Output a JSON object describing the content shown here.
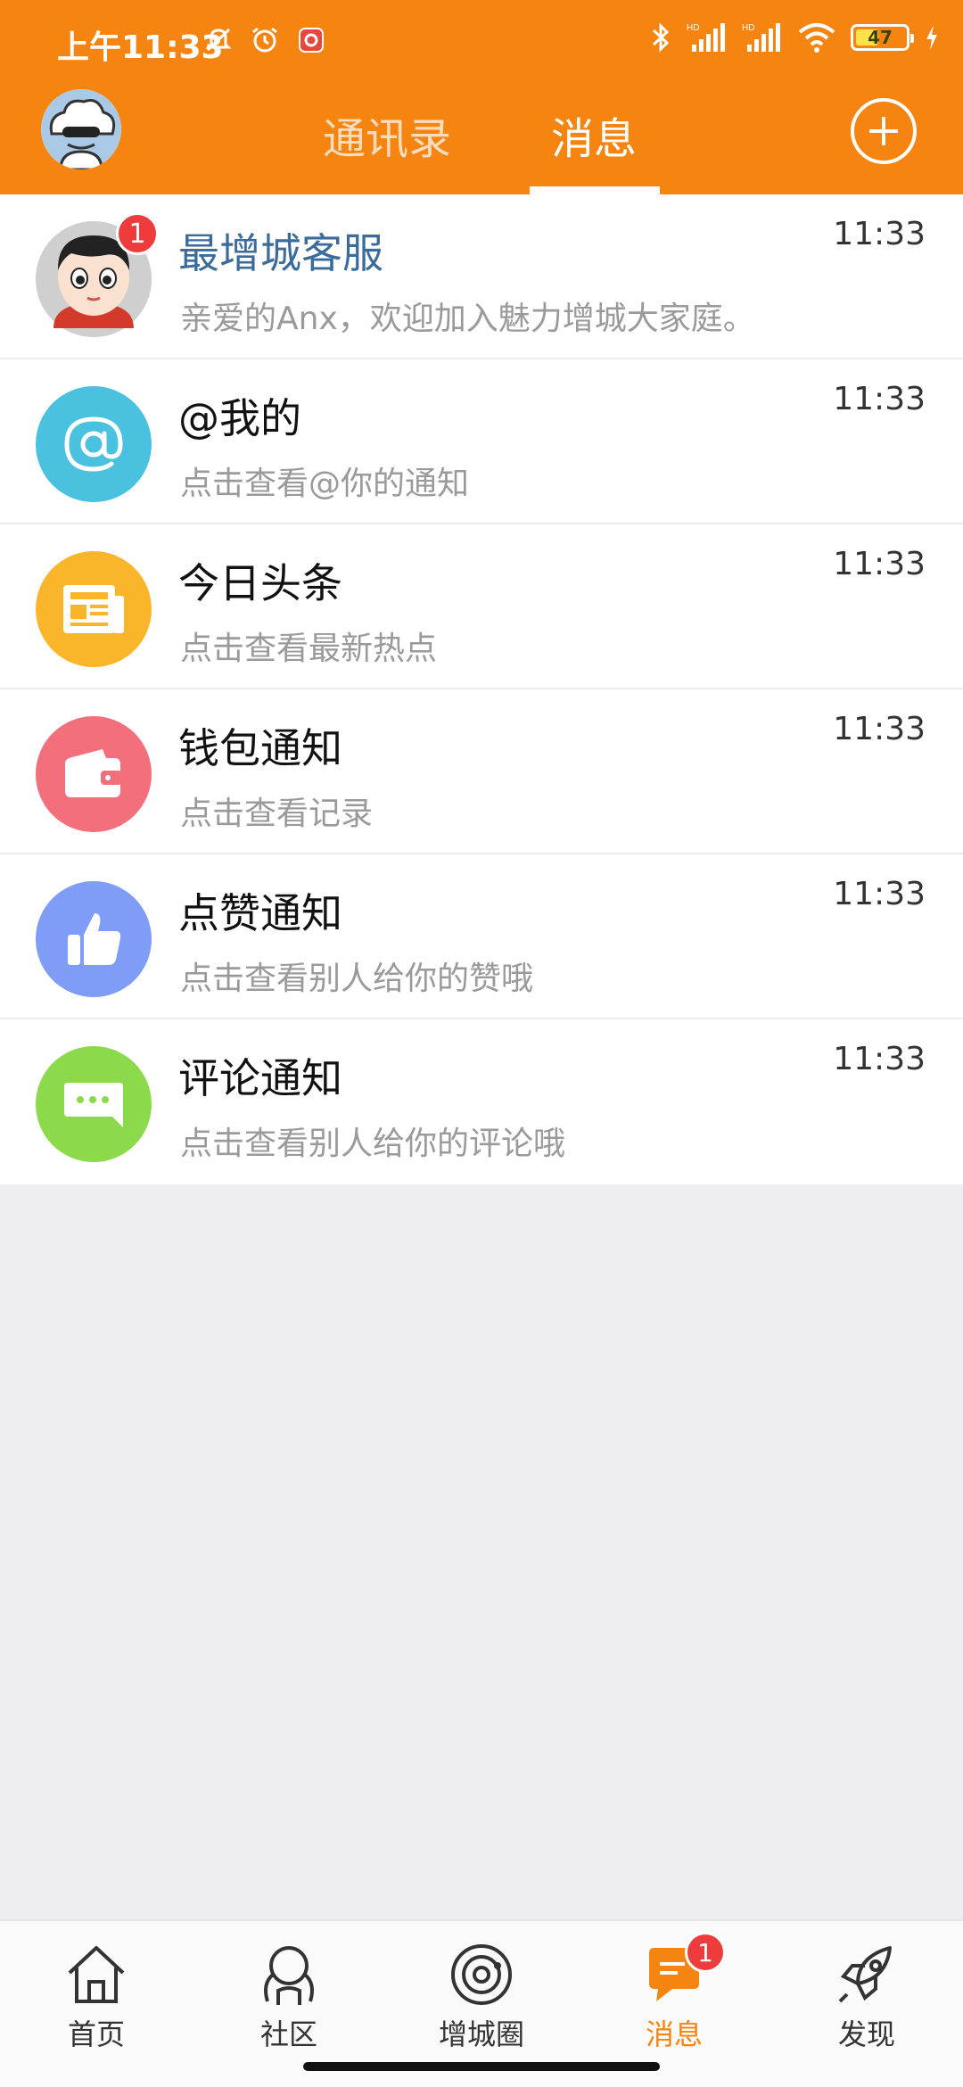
{
  "status_bar": {
    "time": "上午11:33",
    "battery": "47",
    "battery_level_percent": 47
  },
  "header": {
    "tabs": [
      {
        "label": "通讯录",
        "active": false
      },
      {
        "label": "消息",
        "active": true
      }
    ]
  },
  "messages": [
    {
      "title": "最增城客服",
      "subtitle": "亲爱的Anx，欢迎加入魅力增城大家庭。",
      "time": "11:33",
      "badge": "1",
      "icon": "user-avatar-icon"
    },
    {
      "title": "@我的",
      "subtitle": "点击查看@你的通知",
      "time": "11:33",
      "icon": "at-icon",
      "color": "#4ac1df"
    },
    {
      "title": "今日头条",
      "subtitle": "点击查看最新热点",
      "time": "11:33",
      "icon": "newspaper-icon",
      "color": "#fbb52a"
    },
    {
      "title": "钱包通知",
      "subtitle": "点击查看记录",
      "time": "11:33",
      "icon": "wallet-icon",
      "color": "#f36f7c"
    },
    {
      "title": "点赞通知",
      "subtitle": "点击查看别人给你的赞哦",
      "time": "11:33",
      "icon": "thumbs-up-icon",
      "color": "#7f9cf7"
    },
    {
      "title": "评论通知",
      "subtitle": "点击查看别人给你的评论哦",
      "time": "11:33",
      "icon": "comment-icon",
      "color": "#8ada4b"
    }
  ],
  "bottom_nav": [
    {
      "label": "首页",
      "icon": "home-icon",
      "active": false
    },
    {
      "label": "社区",
      "icon": "community-icon",
      "active": false
    },
    {
      "label": "增城圈",
      "icon": "planet-icon",
      "active": false
    },
    {
      "label": "消息",
      "icon": "message-icon",
      "active": true,
      "badge": "1"
    },
    {
      "label": "发现",
      "icon": "rocket-icon",
      "active": false
    }
  ],
  "colors": {
    "brand": "#f68410",
    "badge": "#ee3b3b",
    "background": "#eeedf0"
  }
}
